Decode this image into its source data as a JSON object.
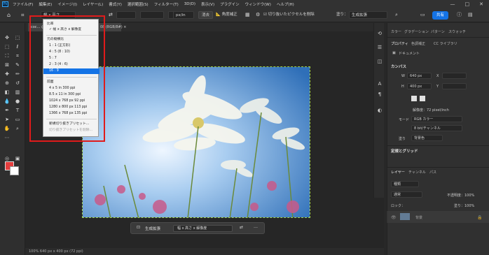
{
  "app": {
    "logo": "Ps"
  },
  "menu": [
    "ファイル(F)",
    "編集(E)",
    "イメージ(I)",
    "レイヤー(L)",
    "書式(Y)",
    "選択範囲(S)",
    "フィルター(T)",
    "3D(D)",
    "表示(V)",
    "プラグイン",
    "ウィンドウ(W)",
    "ヘルプ(H)"
  ],
  "window_controls": [
    "—",
    "□",
    "✕"
  ],
  "options": {
    "ratio_value": "幅 x 高さ",
    "unit": "px/in",
    "clear_label": "消去",
    "straighten_label": "角度補正",
    "delete_cropped": "切り抜いたピクセルを削除",
    "fill_label": "塗り：",
    "fill_value": "生成拡張",
    "share": "共有"
  },
  "doc_tab": "coc…  @ 100% (RGB/8#)",
  "doc_tab2": "08 (RGB/8#) ×",
  "status": "100%      640 px x 400 px (72 ppi)",
  "dropdown": {
    "items": [
      {
        "label": "比率",
        "type": "header"
      },
      {
        "label": "✓ 幅 x 高さ x 解像度",
        "type": "item"
      },
      {
        "label": "元の縦横比",
        "type": "header"
      },
      {
        "label": "1 : 1 (正方形)",
        "type": "item"
      },
      {
        "label": "4 : 5 (8 : 10)",
        "type": "item"
      },
      {
        "label": "5 : 7",
        "type": "item"
      },
      {
        "label": "2 : 3 (4 : 6)",
        "type": "item"
      },
      {
        "label": "16 : 9",
        "type": "selected"
      },
      {
        "label": "前面",
        "type": "header"
      },
      {
        "label": "4 x 5 in 300 ppi",
        "type": "item"
      },
      {
        "label": "8.5 x 11 in 300 ppi",
        "type": "item"
      },
      {
        "label": "1024 x 768 px 92 ppi",
        "type": "item"
      },
      {
        "label": "1280 x 800 px 113 ppi",
        "type": "item"
      },
      {
        "label": "1366 x 768 px 135 ppi",
        "type": "item"
      },
      {
        "label": "新規切り抜きプリセット...",
        "type": "item"
      },
      {
        "label": "切り抜きプリセットを削除...",
        "type": "disabled"
      }
    ]
  },
  "taskbar": {
    "generative_expand": "生成拡張",
    "ratio_select": "幅 x 高さ x 解像度",
    "more": "…"
  },
  "right_panel": {
    "tabs_top": [
      "カラー",
      "グラデーション",
      "パターン",
      "スウォッチ"
    ],
    "tabs_props": [
      "プロパティ",
      "色調補正",
      "CC ライブラリ"
    ],
    "doc_label": "ドキュメント",
    "canvas_section": "カンバス",
    "w_label": "W",
    "w_value": "640 px",
    "h_label": "H",
    "h_value": "400 px",
    "x_label": "X",
    "y_label": "Y",
    "resolution": "解像度：72 pixel/inch",
    "mode_label": "モード",
    "mode_value": "RGB カラー",
    "depth_value": "8 bit/チャンネル",
    "fill_label": "塗り",
    "fill_value": "背景色",
    "grid_section": "定規とグリッド",
    "layer_tabs": [
      "レイヤー",
      "チャンネル",
      "パス"
    ],
    "search_placeholder": "種類",
    "blend_mode": "通常",
    "opacity_label": "不透明度：100%",
    "lock_label": "ロック：",
    "fill_pct": "塗り：100%",
    "layer_name": "背景"
  },
  "colors": {
    "accent": "#1473e6",
    "highlight_box": "#e01b1b",
    "fg_color": "#e53e3e",
    "bg_color": "#ffffff"
  }
}
